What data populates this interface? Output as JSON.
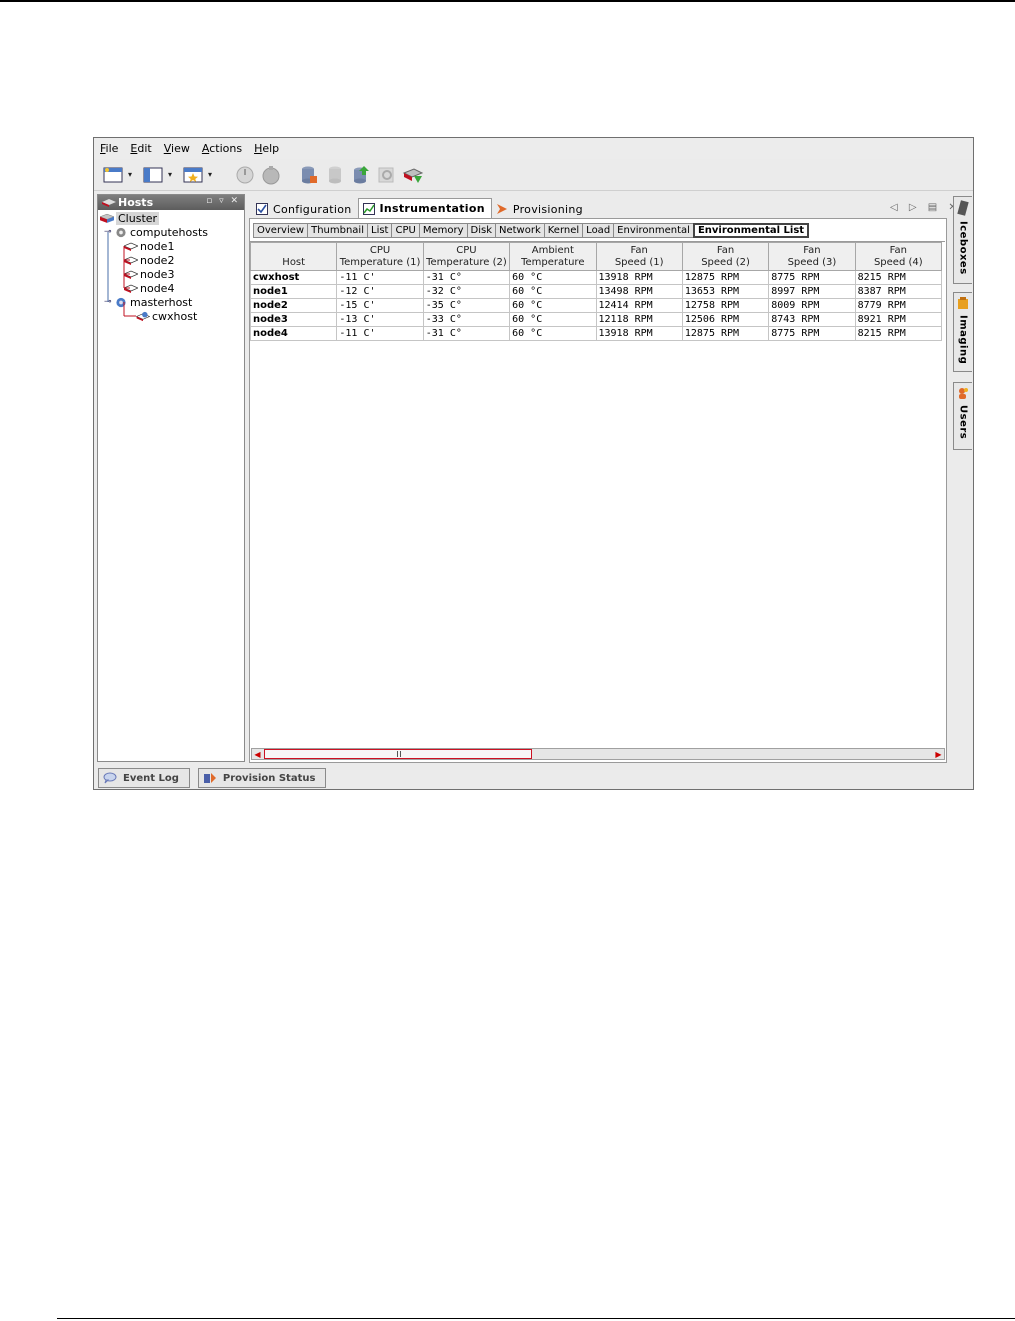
{
  "menu": [
    "File",
    "Edit",
    "View",
    "Actions",
    "Help"
  ],
  "hosts_panel": {
    "title": "Hosts",
    "tree": {
      "root": "Cluster",
      "groups": [
        {
          "name": "computehosts",
          "children": [
            "node1",
            "node2",
            "node3",
            "node4"
          ]
        },
        {
          "name": "masterhost",
          "children": [
            "cwxhost"
          ]
        }
      ]
    }
  },
  "main_tabs": [
    {
      "label": "Configuration",
      "active": false
    },
    {
      "label": "Instrumentation",
      "active": true
    },
    {
      "label": "Provisioning",
      "active": false
    }
  ],
  "sub_tabs": [
    {
      "label": "Overview",
      "active": false
    },
    {
      "label": "Thumbnail",
      "active": false
    },
    {
      "label": "List",
      "active": false
    },
    {
      "label": "CPU",
      "active": false
    },
    {
      "label": "Memory",
      "active": false
    },
    {
      "label": "Disk",
      "active": false
    },
    {
      "label": "Network",
      "active": false
    },
    {
      "label": "Kernel",
      "active": false
    },
    {
      "label": "Load",
      "active": false
    },
    {
      "label": "Environmental",
      "active": false
    },
    {
      "label": "Environmental List",
      "active": true
    }
  ],
  "table": {
    "columns": [
      [
        "",
        "Host"
      ],
      [
        "CPU",
        "Temperature (1)"
      ],
      [
        "CPU",
        "Temperature (2)"
      ],
      [
        "Ambient",
        "Temperature"
      ],
      [
        "Fan",
        "Speed (1)"
      ],
      [
        "Fan",
        "Speed (2)"
      ],
      [
        "Fan",
        "Speed (3)"
      ],
      [
        "Fan",
        "Speed (4)"
      ]
    ],
    "rows": [
      [
        "cwxhost",
        "-11 C'",
        "-31 C°",
        "60 °C",
        "13918 RPM",
        "12875 RPM",
        "8775 RPM",
        "8215 RPM"
      ],
      [
        "node1",
        "-12 C'",
        "-32 C°",
        "60 °C",
        "13498 RPM",
        "13653 RPM",
        "8997 RPM",
        "8387 RPM"
      ],
      [
        "node2",
        "-15 C'",
        "-35 C°",
        "60 °C",
        "12414 RPM",
        "12758 RPM",
        "8009 RPM",
        "8779 RPM"
      ],
      [
        "node3",
        "-13 C'",
        "-33 C°",
        "60 °C",
        "12118 RPM",
        "12506 RPM",
        "8743 RPM",
        "8921 RPM"
      ],
      [
        "node4",
        "-11 C'",
        "-31 C°",
        "60 °C",
        "13918 RPM",
        "12875 RPM",
        "8775 RPM",
        "8215 RPM"
      ]
    ]
  },
  "side_tabs": [
    "Iceboxes",
    "Imaging",
    "Users"
  ],
  "bottom_tabs": [
    "Event Log",
    "Provision Status"
  ],
  "icons": {
    "toolbar": [
      "new-window-icon",
      "layout-icon",
      "favorites-icon",
      "power-on-icon",
      "power-off-icon",
      "database-edit-icon",
      "database-icon",
      "database-upload-icon",
      "search-icon",
      "provision-icon"
    ]
  },
  "colors": {
    "accent_red": "#c01020",
    "header_gray": "#6a6a6a"
  }
}
